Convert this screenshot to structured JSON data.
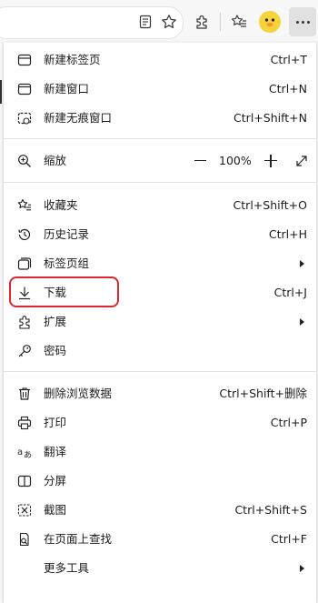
{
  "toolbar": {
    "icons": [
      "reading-view-icon",
      "favorite-star-icon",
      "extensions-icon",
      "favorites-icon",
      "profile-avatar-icon",
      "more-icon"
    ]
  },
  "menu": {
    "items": [
      {
        "label": "新建标签页",
        "shortcut": "Ctrl+T",
        "icon": "new-tab-icon"
      },
      {
        "label": "新建窗口",
        "shortcut": "Ctrl+N",
        "icon": "new-window-icon"
      },
      {
        "label": "新建无痕窗口",
        "shortcut": "Ctrl+Shift+N",
        "icon": "inprivate-window-icon"
      },
      {
        "label": "缩放",
        "zoom_value": "100%",
        "icon": "zoom-icon"
      },
      {
        "label": "收藏夹",
        "shortcut": "Ctrl+Shift+O",
        "icon": "favorites-icon"
      },
      {
        "label": "历史记录",
        "shortcut": "Ctrl+H",
        "icon": "history-icon"
      },
      {
        "label": "标签页组",
        "submenu": true,
        "icon": "tab-groups-icon"
      },
      {
        "label": "下载",
        "shortcut": "Ctrl+J",
        "icon": "download-icon",
        "highlighted": true
      },
      {
        "label": "扩展",
        "submenu": true,
        "icon": "extensions-icon"
      },
      {
        "label": "密码",
        "icon": "key-icon"
      },
      {
        "label": "删除浏览数据",
        "shortcut": "Ctrl+Shift+删除",
        "icon": "trash-icon"
      },
      {
        "label": "打印",
        "shortcut": "Ctrl+P",
        "icon": "print-icon"
      },
      {
        "label": "翻译",
        "icon": "translate-icon"
      },
      {
        "label": "分屏",
        "icon": "split-screen-icon"
      },
      {
        "label": "截图",
        "shortcut": "Ctrl+Shift+S",
        "icon": "screenshot-icon"
      },
      {
        "label": "在页面上查找",
        "shortcut": "Ctrl+F",
        "icon": "find-on-page-icon"
      },
      {
        "label": "更多工具",
        "submenu": true,
        "icon": ""
      }
    ]
  },
  "colors": {
    "highlight": "#d9282f",
    "toolbar_bg": "#f7f7f7",
    "avatar": "#f5d33b"
  }
}
